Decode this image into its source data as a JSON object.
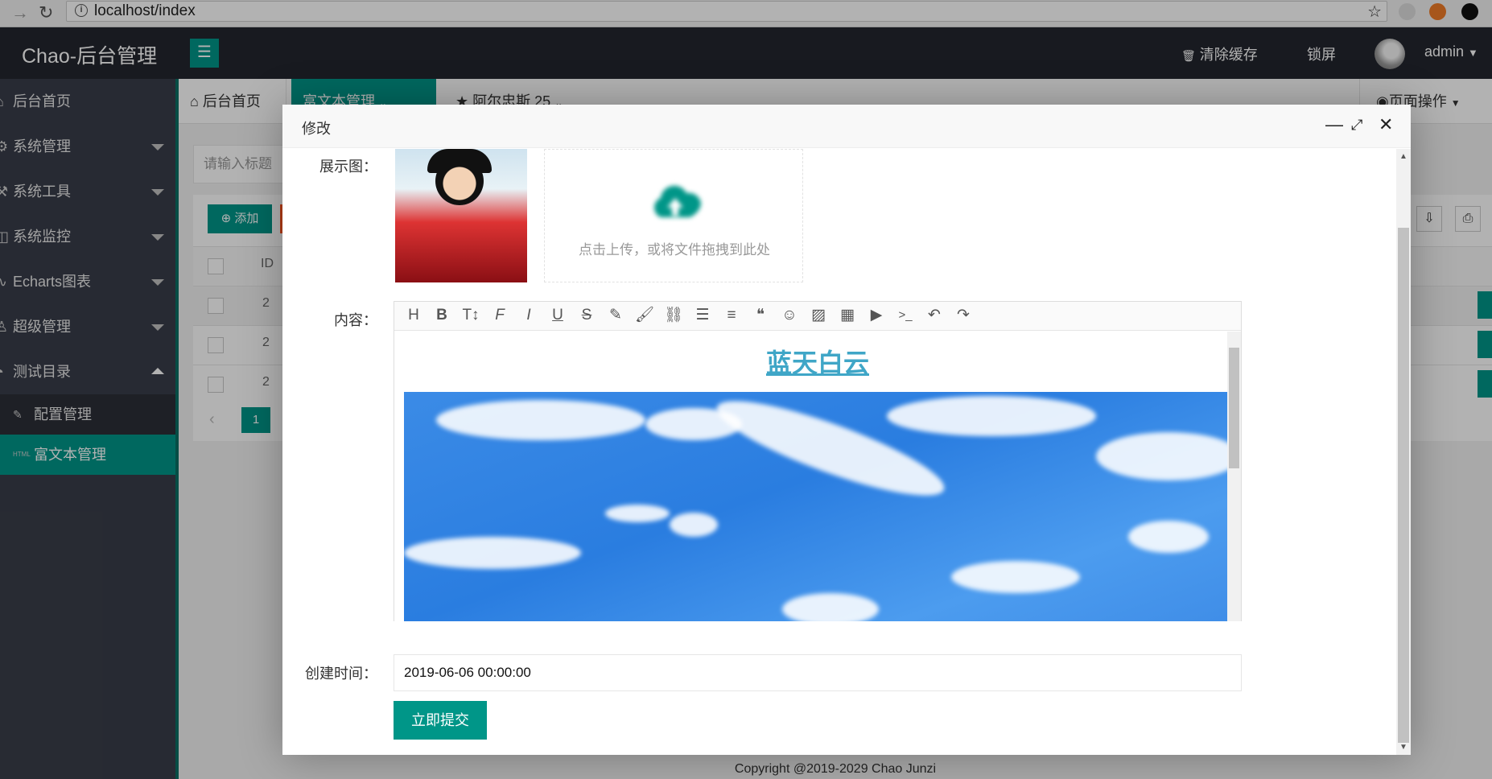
{
  "browser": {
    "url": "localhost/index"
  },
  "header": {
    "app_title": "Chao-后台管理",
    "clear_cache": "清除缓存",
    "lock_screen": "锁屏",
    "user": "admin"
  },
  "sidebar": {
    "items": [
      {
        "label": "后台首页"
      },
      {
        "label": "系统管理"
      },
      {
        "label": "系统工具"
      },
      {
        "label": "系统监控"
      },
      {
        "label": "Echarts图表"
      },
      {
        "label": "超级管理"
      },
      {
        "label": "测试目录"
      }
    ],
    "sub_items": [
      {
        "label": "配置管理"
      },
      {
        "label": "富文本管理"
      }
    ]
  },
  "tabs": [
    {
      "label": "后台首页"
    },
    {
      "label": "富文本管理"
    },
    {
      "label": "阿尔忠斯 25"
    }
  ],
  "page_ops": "页面操作",
  "list": {
    "search_placeholder": "请输入标题",
    "add_button": "添加",
    "column_id": "ID",
    "rows": [
      {
        "id": "2"
      },
      {
        "id": "2"
      },
      {
        "id": "2"
      }
    ],
    "page": "1"
  },
  "footer": "Copyright @2019-2029 Chao Junzi",
  "modal": {
    "title": "修改",
    "label_image": "展示图：",
    "upload_text": "点击上传，或将文件拖拽到此处",
    "label_content": "内容：",
    "editor_heading": "蓝天白云",
    "label_created": "创建时间：",
    "created_value": "2019-06-06 00:00:00",
    "submit": "立即提交"
  },
  "colors": {
    "accent": "#009688",
    "sidebar": "#393d49",
    "topbar": "#23262e",
    "danger": "#ff5722"
  }
}
